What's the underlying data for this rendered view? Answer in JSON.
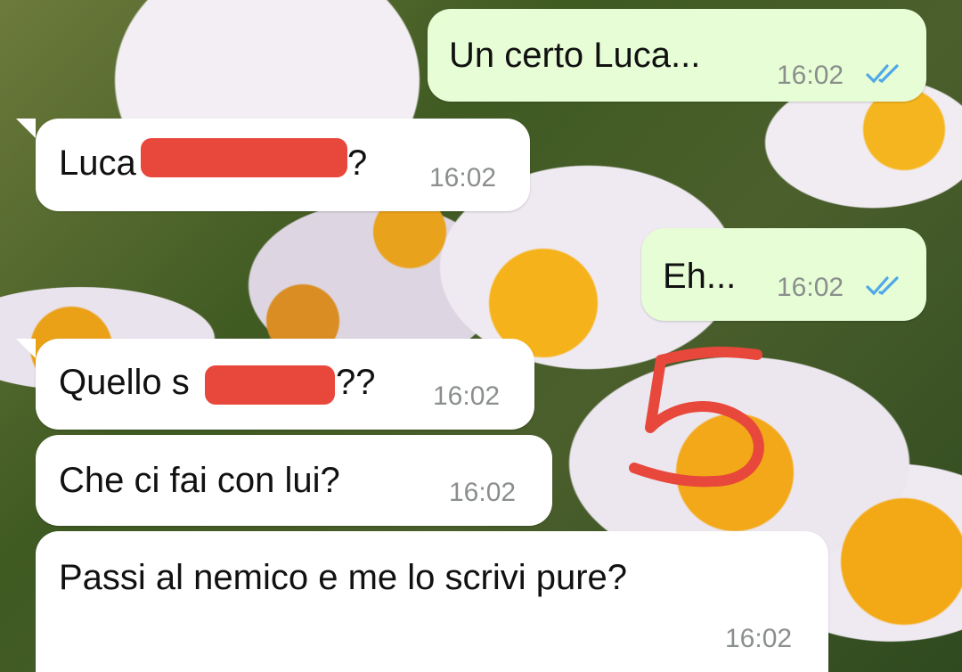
{
  "messages": [
    {
      "id": 1,
      "direction": "outgoing",
      "text": "Un certo Luca...",
      "time": "16:02",
      "status": "read-double-check"
    },
    {
      "id": 2,
      "direction": "incoming",
      "text_prefix": "Luca",
      "text_suffix": "?",
      "redacted": true,
      "time": "16:02"
    },
    {
      "id": 3,
      "direction": "outgoing",
      "text": "Eh...",
      "time": "16:02",
      "status": "read-double-check"
    },
    {
      "id": 4,
      "direction": "incoming",
      "text_prefix": "Quello s",
      "text_suffix": "??",
      "redacted": true,
      "time": "16:02"
    },
    {
      "id": 5,
      "direction": "incoming",
      "text": "Che ci fai con lui?",
      "time": "16:02"
    },
    {
      "id": 6,
      "direction": "incoming",
      "text": "Passi al nemico e me lo scrivi pure?",
      "time": "16:02"
    }
  ],
  "annotation": {
    "text": "5",
    "color": "#e8473b"
  },
  "colors": {
    "outgoing_bubble": "#e7fdd6",
    "incoming_bubble": "#ffffff",
    "read_ticks": "#4fa8e8",
    "timestamp": "#8a8f8c",
    "redaction": "#e8473b"
  },
  "icons": {
    "read_receipt": "double-check-icon",
    "wallpaper": "daisy-wallpaper"
  }
}
